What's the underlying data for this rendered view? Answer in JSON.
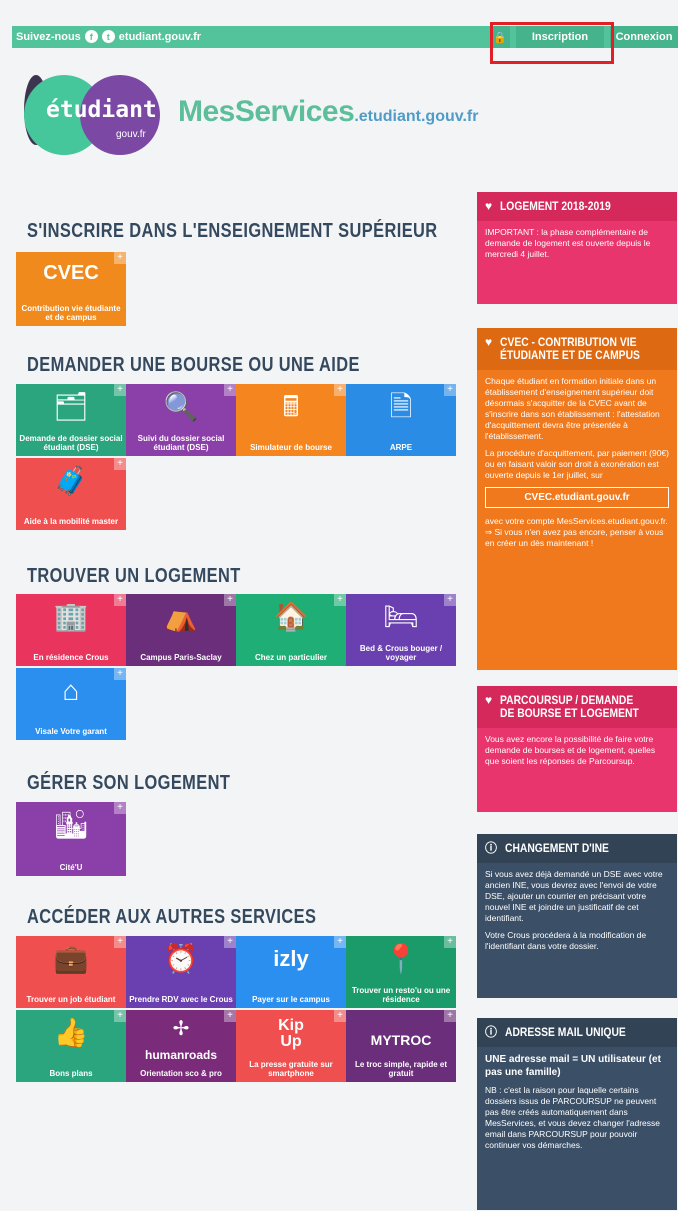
{
  "topbar": {
    "follow": "Suivez-nous",
    "site": "etudiant.gouv.fr",
    "inscription": "Inscription",
    "connexion": "Connexion"
  },
  "logo": {
    "main": "étudiant",
    "sub": "gouv.fr"
  },
  "brand": {
    "main": "MesServices",
    "sub": ".etudiant.gouv.fr"
  },
  "sections": {
    "s1": "S'INSCRIRE DANS L'ENSEIGNEMENT SUPÉRIEUR",
    "s2": "DEMANDER UNE BOURSE OU UNE AIDE",
    "s3": "TROUVER UN LOGEMENT",
    "s4": "GÉRER SON LOGEMENT",
    "s5": "ACCÉDER AUX AUTRES SERVICES"
  },
  "tiles": {
    "cvec_title": "CVEC",
    "cvec_label": "Contribution vie étudiante et de campus",
    "dse": "Demande de dossier social étudiant (DSE)",
    "suivi": "Suivi du dossier social étudiant (DSE)",
    "simulateur": "Simulateur de bourse",
    "arpe": "ARPE",
    "mobilite": "Aide à la mobilité master",
    "residence": "En résidence Crous",
    "campus": "Campus Paris-Saclay",
    "particulier": "Chez un particulier",
    "bedcrous": "Bed & Crous bouger / voyager",
    "visale": "Visale Votre garant",
    "citeu": "Cité'U",
    "job": "Trouver un job étudiant",
    "rdv": "Prendre RDV avec le Crous",
    "izly": "Payer sur le campus",
    "restou": "Trouver un resto'u ou une résidence",
    "bonsplans": "Bons plans",
    "humanroads": "humanroads",
    "humanroads_label": "Orientation sco & pro",
    "kipup": "La presse gratuite sur smartphone",
    "mytroc": "MYTROC",
    "mytroc_label": "Le troc simple, rapide et gratuit"
  },
  "panels": {
    "logement": {
      "title": "LOGEMENT 2018-2019",
      "text": "IMPORTANT : la phase complémentaire de demande de logement est ouverte depuis le mercredi 4 juillet."
    },
    "cvec": {
      "title": "CVEC - CONTRIBUTION VIE ÉTUDIANTE ET DE CAMPUS",
      "p1": "Chaque étudiant en formation initiale dans un établissement d'enseignement supérieur doit désormais s'acquitter de la CVEC avant de s'inscrire dans son établissement : l'attestation d'acquittement devra être présentée à l'établissement.",
      "p2": "La procédure d'acquittement, par paiement (90€) ou en faisant valoir son droit à exonération est ouverte depuis le 1er juillet, sur",
      "link": "CVEC.etudiant.gouv.fr",
      "p3": "avec votre compte MesServices.etudiant.gouv.fr.",
      "p4": "⇒ Si vous n'en avez pas encore, penser à vous en créer un dès maintenant !"
    },
    "parcoursup": {
      "title": "PARCOURSUP / DEMANDE DE BOURSE ET LOGEMENT",
      "text": "Vous avez encore la possibilité de faire votre demande de bourses et de logement, quelles que soient les réponses de Parcoursup."
    },
    "ine": {
      "title": "CHANGEMENT D'INE",
      "p1": "Si vous avez déjà demandé un DSE avec votre ancien INE, vous devrez avec l'envoi de votre DSE, ajouter un courrier en précisant votre nouvel INE et joindre un justificatif de cet identifiant.",
      "p2": "Votre Crous procédera à la modification de l'identifiant dans votre dossier."
    },
    "mail": {
      "title": "ADRESSE MAIL UNIQUE",
      "p1": "UNE adresse mail = UN utilisateur (et pas une famille)",
      "p2": "NB : c'est la raison pour laquelle certains dossiers issus de PARCOURSUP ne peuvent pas être créés automatiquement dans MesServices, et vous devez changer l'adresse email dans PARCOURSUP pour pouvoir continuer vos démarches."
    }
  }
}
